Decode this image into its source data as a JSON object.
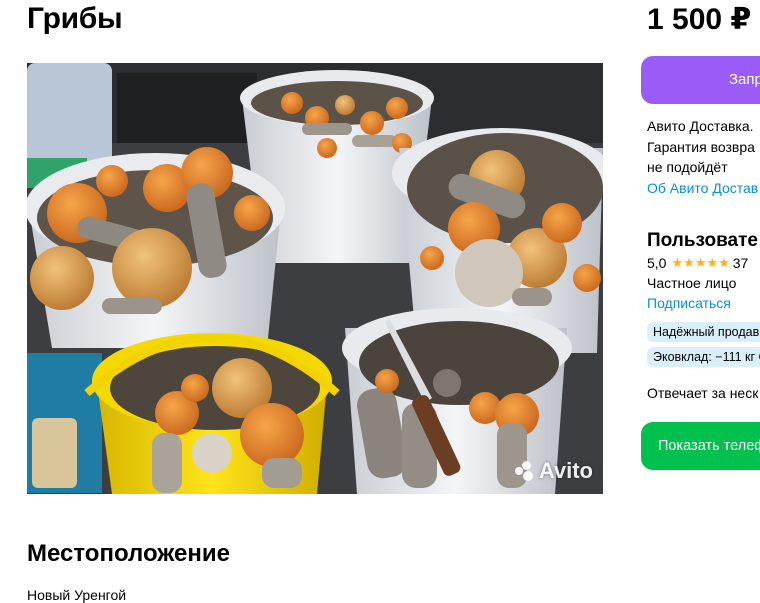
{
  "listing": {
    "title": "Грибы",
    "price": "1 500 ₽"
  },
  "photo": {
    "watermark": "Avito"
  },
  "actions": {
    "request_label": "Запр",
    "phone_label": "Показать телеф"
  },
  "delivery": {
    "line1": "Авито Доставка.",
    "line2": "Гарантия возвра",
    "line3": "не подойдёт",
    "link": "Об Авито Достав"
  },
  "seller": {
    "name": "Пользовате",
    "rating": "5,0",
    "stars": "★★★★★",
    "reviews": "37",
    "type": "Частное лицо",
    "subscribe": "Подписаться",
    "badge_reliable": "Надёжный продав",
    "badge_eco": "Эковклад: −111 кг С",
    "reply_text": "Отвечает за неск"
  },
  "location": {
    "title": "Местоположение",
    "city": "Новый Уренгой"
  },
  "colors": {
    "accent_purple": "#9a5bf6",
    "accent_green": "#00c14d",
    "link_blue": "#0a8ed9",
    "star_orange": "#ffb021",
    "badge_blue": "#d9f0fb"
  }
}
